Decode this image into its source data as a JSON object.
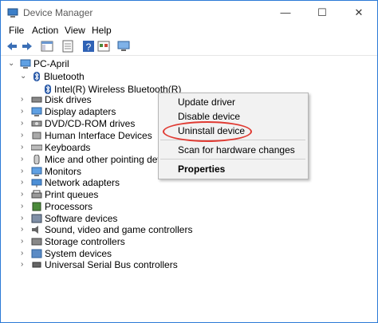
{
  "window": {
    "title": "Device Manager",
    "controls": {
      "minimize": "—",
      "maximize": "☐",
      "close": "✕"
    }
  },
  "menu": [
    "File",
    "Action",
    "View",
    "Help"
  ],
  "tree": {
    "root": "PC-April",
    "bluetooth": {
      "label": "Bluetooth",
      "child": "Intel(R) Wireless Bluetooth(R)"
    },
    "categories": [
      "Disk drives",
      "Display adapters",
      "DVD/CD-ROM drives",
      "Human Interface Devices",
      "Keyboards",
      "Mice and other pointing devices",
      "Monitors",
      "Network adapters",
      "Print queues",
      "Processors",
      "Sound, video and game controllers",
      "Storage controllers",
      "System devices",
      "Universal Serial Bus controllers"
    ],
    "devices_hidden_extra": "Software devices"
  },
  "context_menu": {
    "items": [
      "Update driver",
      "Disable device",
      "Uninstall device",
      "Scan for hardware changes",
      "Properties"
    ],
    "highlighted": "Uninstall device"
  },
  "colors": {
    "accent": "#2b79d6",
    "annotation": "#e03a32"
  }
}
